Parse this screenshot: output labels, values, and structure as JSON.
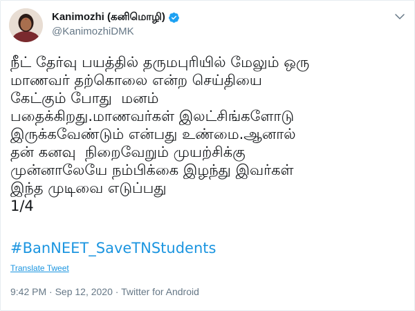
{
  "tweet": {
    "display_name": "Kanimozhi (கனிமொழி)",
    "handle": "@KanimozhiDMK",
    "verified": true,
    "menu_icon": "chevron-down-icon",
    "text_lines": [
      "நீட் தேர்வு பயத்தில் தருமபுரியில் மேலும் ஒரு",
      "மாணவர் தற்கொலை என்ற செய்தியை",
      "கேட்கும் போது  மனம்",
      "பதைக்கிறது.மாணவர்கள் இலட்சிங்களோடு",
      "இருக்கவேண்டும் என்பது உண்மை.ஆனால்",
      "தன் கனவு  நிறைவேறும் முயற்சிக்கு",
      "முன்னாலேயே நம்பிக்கை இழந்து இவர்கள்",
      "இந்த முடிவை எடுப்பது",
      "1/4"
    ],
    "hashtag": "#BanNEET_SaveTNStudents",
    "translate_label": "Translate Tweet",
    "timestamp": "9:42 PM · Sep 12, 2020 · Twitter for Android"
  },
  "colors": {
    "link": "#1b95e0",
    "secondary_text": "#657786",
    "verified_badge": "#1da1f2"
  }
}
